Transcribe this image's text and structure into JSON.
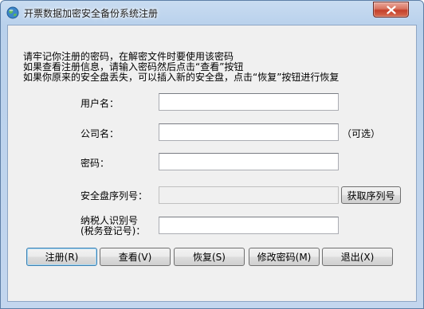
{
  "window": {
    "title": "开票数据加密安全备份系统注册",
    "close_glyph": "✕"
  },
  "info": {
    "line1": "请牢记你注册的密码，在解密文件时要使用该密码",
    "line2": "如果查看注册信息，请输入密码然后点击“查看”按钮",
    "line3": "如果你原来的安全盘丢失，可以插入新的安全盘，点击“恢复”按钮进行恢复"
  },
  "form": {
    "username_label": "用户名：",
    "username_value": "",
    "company_label": "公司名：",
    "company_value": "",
    "company_hint": "（可选）",
    "password_label": "密码：",
    "password_value": "",
    "serial_label": "安全盘序列号：",
    "serial_value": "",
    "get_serial_label": "获取序列号",
    "taxid_label_1": "纳税人识别号",
    "taxid_label_2": "(税务登记号)：",
    "taxid_value": ""
  },
  "buttons": {
    "register": "注册(R)",
    "view": "查看(V)",
    "restore": "恢复(S)",
    "change_password": "修改密码(M)",
    "exit": "退出(X)"
  },
  "icons": {
    "app": "globe-icon",
    "close": "close-icon"
  },
  "colors": {
    "titlebar": "#c3d6ee",
    "dialog_background": "#f0f0f0",
    "close_button": "#c4402a"
  }
}
